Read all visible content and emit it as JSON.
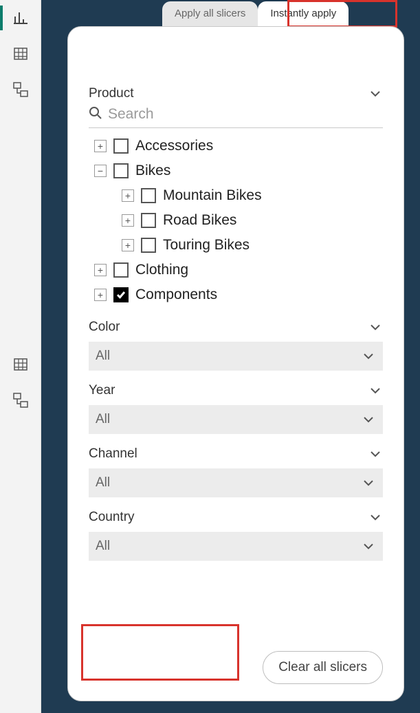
{
  "nav": {
    "items": [
      {
        "icon": "bar-chart-icon",
        "active": true
      },
      {
        "icon": "table-icon",
        "active": false
      },
      {
        "icon": "hierarchy-icon",
        "active": false
      }
    ],
    "bottomItems": [
      {
        "icon": "table-icon"
      },
      {
        "icon": "hierarchy-icon"
      }
    ]
  },
  "tabs": {
    "apply_all": "Apply all slicers",
    "instantly_apply": "Instantly apply"
  },
  "slicers": {
    "product": {
      "title": "Product",
      "search_placeholder": "Search",
      "tree": [
        {
          "label": "Accessories",
          "expand": "+",
          "checked": false
        },
        {
          "label": "Bikes",
          "expand": "-",
          "checked": false,
          "children": [
            {
              "label": "Mountain Bikes",
              "expand": "+",
              "checked": false
            },
            {
              "label": "Road Bikes",
              "expand": "+",
              "checked": false
            },
            {
              "label": "Touring Bikes",
              "expand": "+",
              "checked": false
            }
          ]
        },
        {
          "label": "Clothing",
          "expand": "+",
          "checked": false
        },
        {
          "label": "Components",
          "expand": "+",
          "checked": true
        }
      ]
    },
    "color": {
      "title": "Color",
      "value": "All"
    },
    "year": {
      "title": "Year",
      "value": "All"
    },
    "channel": {
      "title": "Channel",
      "value": "All"
    },
    "country": {
      "title": "Country",
      "value": "All"
    }
  },
  "footer": {
    "clear_all": "Clear all slicers"
  },
  "colors": {
    "highlight": "#d8332c"
  }
}
